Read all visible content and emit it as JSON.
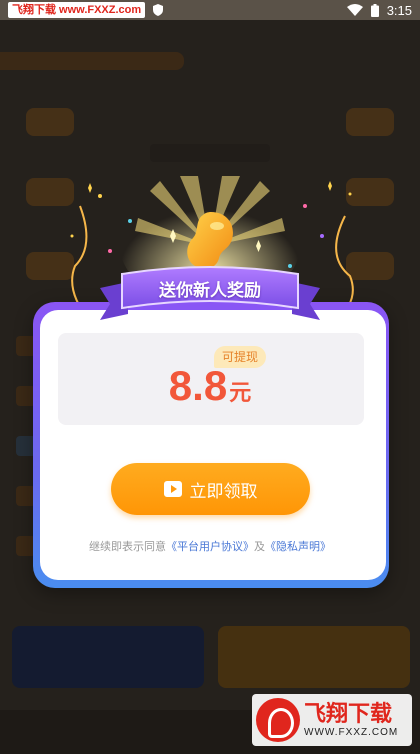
{
  "status_bar": {
    "watermark": "飞翔下载 www.FXXZ.com",
    "time": "3:15"
  },
  "modal": {
    "banner_title": "送你新人奖励",
    "badge": "可提现",
    "amount": "8.8",
    "unit": "元",
    "claim_button": "立即领取",
    "agreement_prefix": "继续即表示同意",
    "user_agreement": "《平台用户协议》",
    "agreement_and": "及",
    "privacy_policy": "《隐私声明》"
  },
  "watermark": {
    "name": "飞翔下载",
    "url": "WWW.FXXZ.COM"
  },
  "colors": {
    "accent_orange": "#ff9606",
    "amount_red": "#f2573a",
    "frame_purple": "#8a55f5",
    "frame_blue": "#4a8df0",
    "link_blue": "#4a78d6"
  },
  "icons": [
    "wifi-icon",
    "battery-icon",
    "shield-icon",
    "gold-bean-icon",
    "video-icon"
  ]
}
